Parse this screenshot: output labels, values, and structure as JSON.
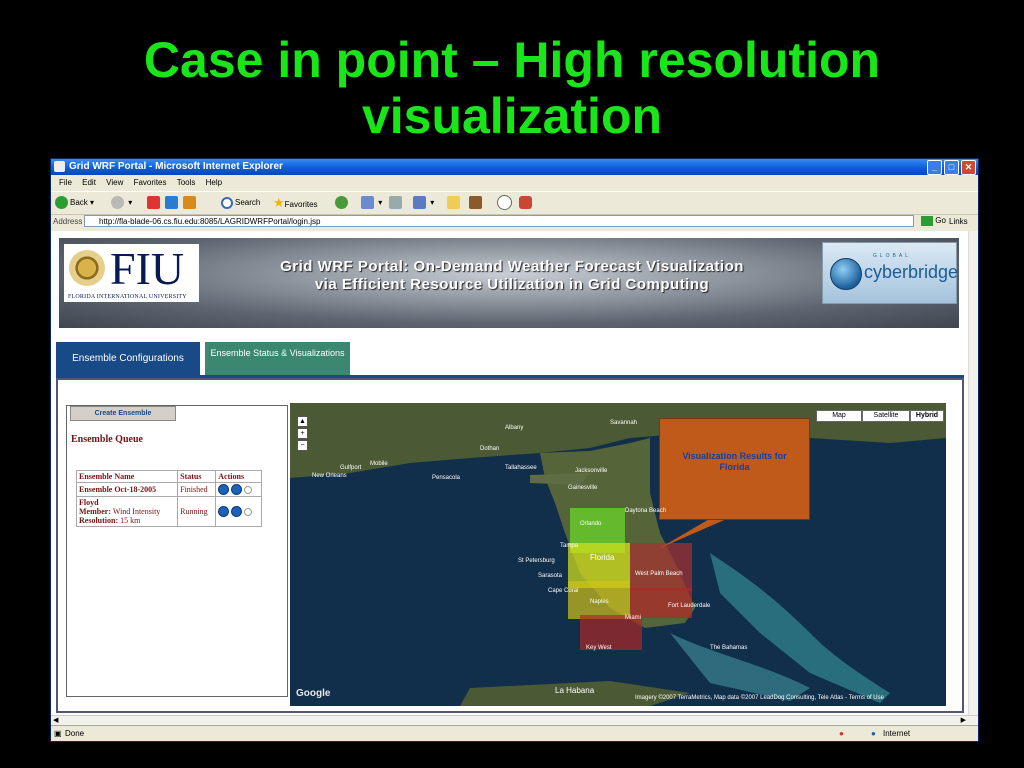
{
  "slide": {
    "title": "Case in point – High resolution visualization"
  },
  "browser": {
    "title": "Grid WRF Portal - Microsoft Internet Explorer",
    "menu": [
      "File",
      "Edit",
      "View",
      "Favorites",
      "Tools",
      "Help"
    ],
    "toolbar": {
      "back": "Back",
      "search": "Search",
      "favorites": "Favorites"
    },
    "address_label": "Address",
    "url": "http://fla-blade-06.cs.fiu.edu:8085/LAGRIDWRFPortal/login.jsp",
    "go": "Go",
    "links": "Links",
    "status": "Done",
    "zone": "Internet"
  },
  "banner": {
    "fiu_big": "FIU",
    "fiu_small": "FLORIDA INTERNATIONAL UNIVERSITY",
    "title_line1": "Grid WRF Portal: On-Demand Weather Forecast Visualization",
    "title_line2": "via Efficient Resource Utilization in Grid Computing",
    "cb_global": "GLOBAL",
    "cb_name": "cyberbridges"
  },
  "tabs": {
    "configs": "Ensemble Configurations",
    "status": "Ensemble Status & Visualizations"
  },
  "ensemble": {
    "create_button": "Create Ensemble",
    "queue_title": "Ensemble Queue",
    "headers": [
      "Ensemble Name",
      "Status",
      "Actions"
    ],
    "rows": [
      {
        "name": "Ensemble Oct-18-2005",
        "status": "Finished"
      },
      {
        "name": "Floyd",
        "member_label": "Member:",
        "member": "Wind Intensity",
        "res_label": "Resolution:",
        "res": "15 km",
        "status": "Running"
      }
    ]
  },
  "map": {
    "types": [
      "Map",
      "Satellite",
      "Hybrid"
    ],
    "active_type": "Hybrid",
    "callout": "Visualization Results for Florida",
    "labels": [
      "New Orleans",
      "Tallahassee",
      "Jacksonville",
      "Gainesville",
      "Orlando",
      "Tampa",
      "St Petersburg",
      "Sarasota",
      "Florida",
      "Cape Coral",
      "West Palm Beach",
      "Fort Lauderdale",
      "Miami",
      "Naples",
      "Key West",
      "Savannah",
      "Albany",
      "Dothan",
      "Pensacola",
      "Mobile",
      "Gulfport",
      "La Habana",
      "The Bahamas",
      "Daytona Beach"
    ],
    "attribution": "Imagery ©2007 TerraMetrics, Map data ©2007 LeadDog Consulting, Tele Atlas - Terms of Use",
    "logo": "Google"
  }
}
